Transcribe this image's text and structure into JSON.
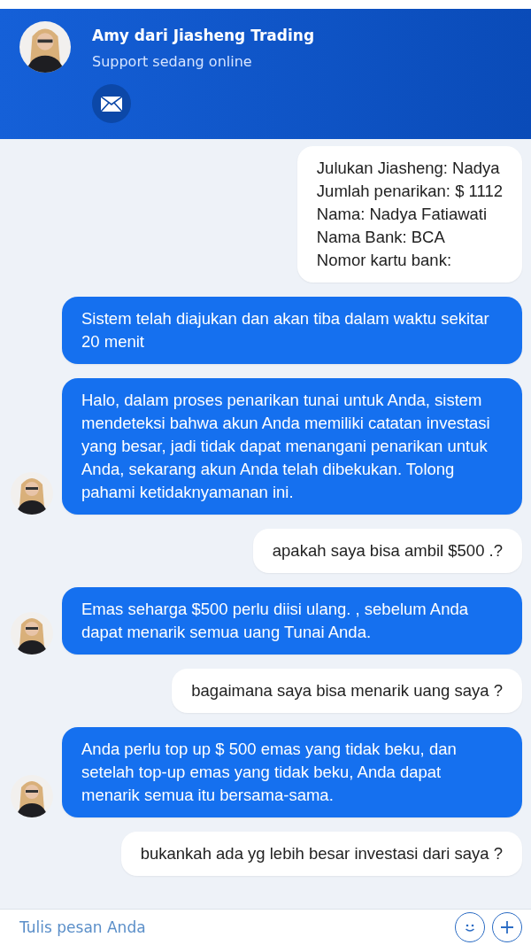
{
  "header": {
    "title": "Amy dari Jiasheng Trading",
    "status": "Support sedang online"
  },
  "messages": [
    {
      "kind": "user",
      "lines": [
        "Julukan Jiasheng: Nadya",
        "Jumlah penarikan: $ 1112",
        "Nama: Nadya Fatiawati",
        "Nama Bank: BCA",
        "Nomor kartu bank:"
      ]
    },
    {
      "kind": "agent",
      "lines": [
        "Sistem telah diajukan dan akan tiba dalam waktu sekitar 20 menit"
      ],
      "avatar": false
    },
    {
      "kind": "agent",
      "lines": [
        "Halo, dalam proses penarikan tunai untuk Anda, sistem mendeteksi bahwa akun Anda memiliki catatan investasi yang besar, jadi tidak dapat menangani penarikan untuk Anda, sekarang akun Anda telah dibekukan. Tolong pahami ketidaknyamanan ini."
      ],
      "avatar": true
    },
    {
      "kind": "user",
      "lines": [
        "apakah saya bisa ambil $500 .?"
      ]
    },
    {
      "kind": "agent",
      "lines": [
        "Emas seharga $500 perlu diisi ulang. , sebelum Anda dapat menarik semua uang Tunai Anda."
      ],
      "avatar": true
    },
    {
      "kind": "user",
      "lines": [
        "bagaimana saya bisa menarik uang saya ?"
      ]
    },
    {
      "kind": "agent",
      "lines": [
        "Anda perlu top up $ 500 emas yang tidak beku, dan setelah top-up emas yang tidak beku, Anda dapat menarik semua itu bersama-sama."
      ],
      "avatar": true
    },
    {
      "kind": "user",
      "lines": [
        "bukankah ada yg lebih besar investasi dari saya ?"
      ]
    }
  ],
  "composer": {
    "placeholder": "Tulis pesan Anda"
  }
}
